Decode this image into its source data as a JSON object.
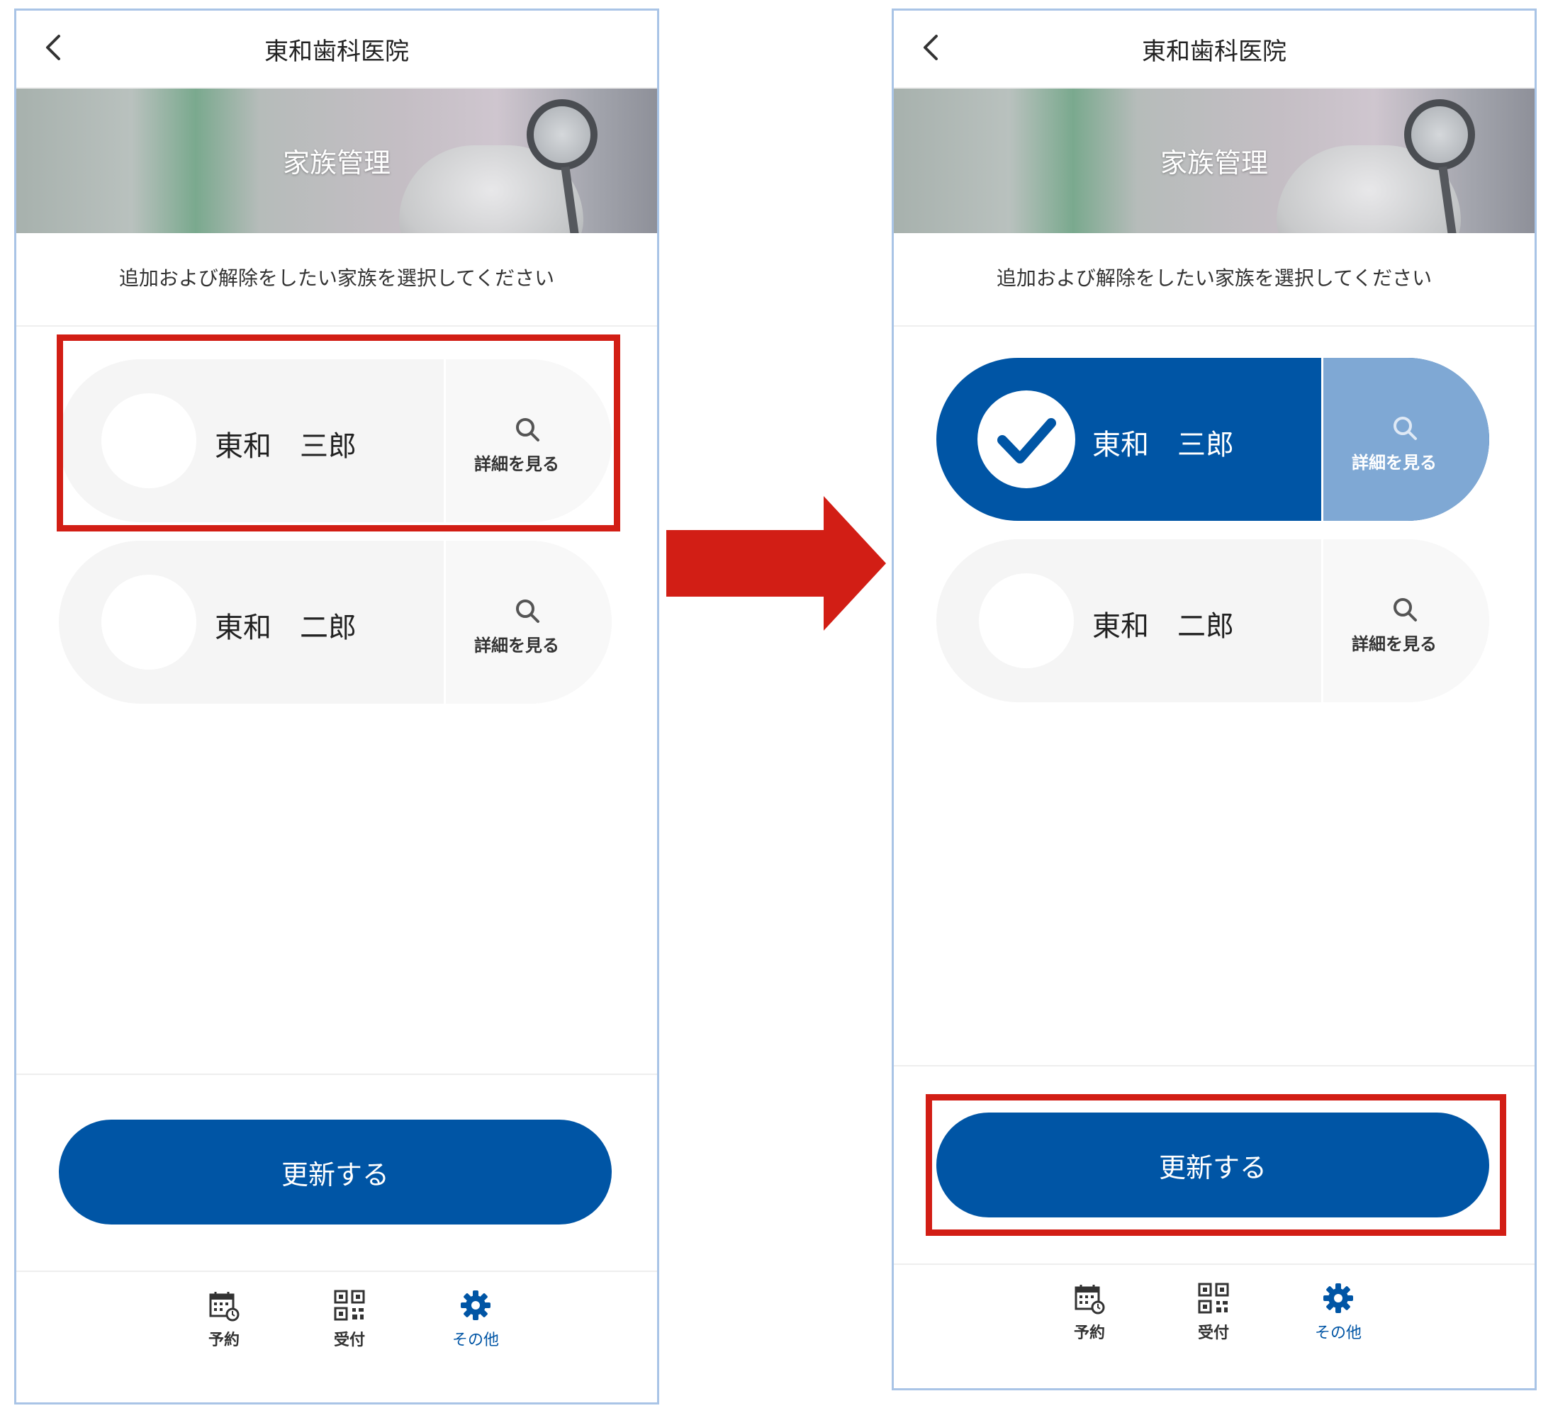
{
  "colors": {
    "primary": "#0055a5",
    "selected_detail": "#7fa8d4",
    "card_bg": "#f5f5f5",
    "highlight": "#d21e15",
    "frame": "#a9c4e6"
  },
  "screens": [
    {
      "header": {
        "title": "東和歯科医院",
        "back_icon": "chevron-left-icon"
      },
      "banner": {
        "title": "家族管理"
      },
      "instruction": "追加および解除をしたい家族を選択してください",
      "members": [
        {
          "name": "東和　三郎",
          "detail_label": "詳細を見る",
          "selected": false
        },
        {
          "name": "東和　二郎",
          "detail_label": "詳細を見る",
          "selected": false
        }
      ],
      "update_label": "更新する",
      "nav": [
        {
          "label": "予約",
          "icon": "calendar-icon",
          "active": false
        },
        {
          "label": "受付",
          "icon": "qr-code-icon",
          "active": false
        },
        {
          "label": "その他",
          "icon": "gear-icon",
          "active": true
        }
      ]
    },
    {
      "header": {
        "title": "東和歯科医院",
        "back_icon": "chevron-left-icon"
      },
      "banner": {
        "title": "家族管理"
      },
      "instruction": "追加および解除をしたい家族を選択してください",
      "members": [
        {
          "name": "東和　三郎",
          "detail_label": "詳細を見る",
          "selected": true
        },
        {
          "name": "東和　二郎",
          "detail_label": "詳細を見る",
          "selected": false
        }
      ],
      "update_label": "更新する",
      "nav": [
        {
          "label": "予約",
          "icon": "calendar-icon",
          "active": false
        },
        {
          "label": "受付",
          "icon": "qr-code-icon",
          "active": false
        },
        {
          "label": "その他",
          "icon": "gear-icon",
          "active": true
        }
      ]
    }
  ]
}
